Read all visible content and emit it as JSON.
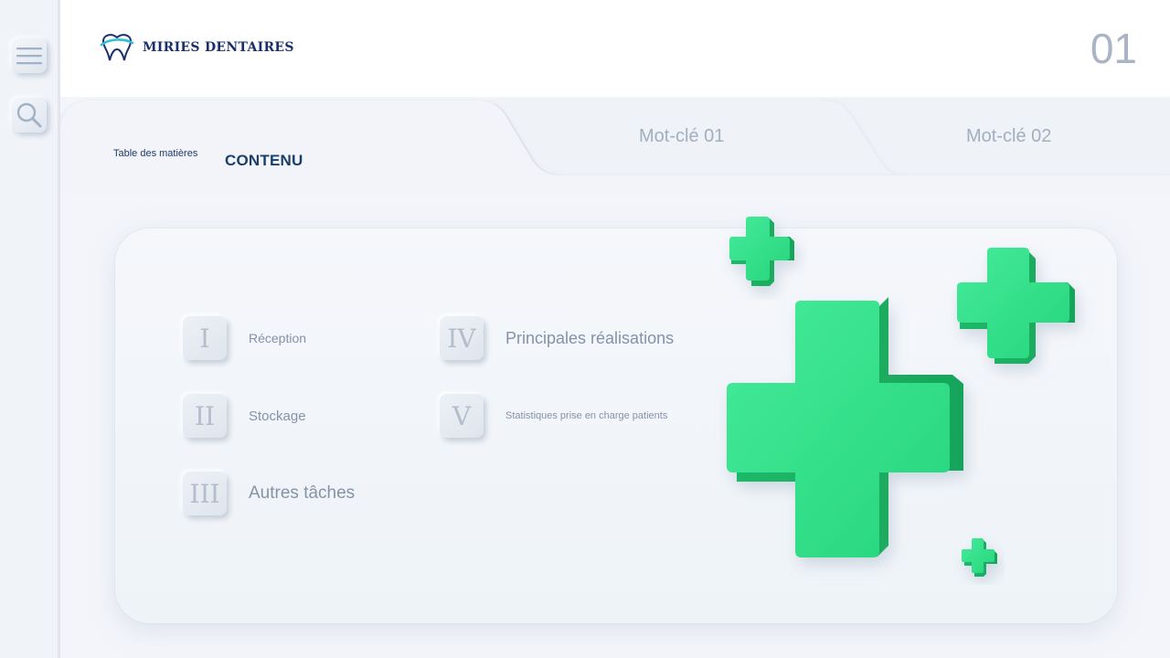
{
  "brand": {
    "name": "MIRIES DENTAIRES",
    "logo_icon": "tooth-logo-icon",
    "color": "#1a2f6d"
  },
  "page_number": "01",
  "sidebar": [
    {
      "name": "menu",
      "icon": "hamburger-menu-icon"
    },
    {
      "name": "search",
      "icon": "search-icon"
    }
  ],
  "toc": {
    "label": "Table des matières",
    "active_tab": "CONTENU"
  },
  "tabs": [
    {
      "label": "Mot-clé 01"
    },
    {
      "label": "Mot-clé 02"
    }
  ],
  "contents": [
    {
      "numeral": "I",
      "label": "Réception"
    },
    {
      "numeral": "II",
      "label": "Stockage"
    },
    {
      "numeral": "III",
      "label": "Autres tâches"
    },
    {
      "numeral": "IV",
      "label": "Principales réalisations"
    },
    {
      "numeral": "V",
      "label": "Statistiques prise en charge patients"
    }
  ],
  "colors": {
    "accent_green": "#2fe187",
    "text_muted": "#8592a8",
    "background": "#f3f5fa"
  }
}
